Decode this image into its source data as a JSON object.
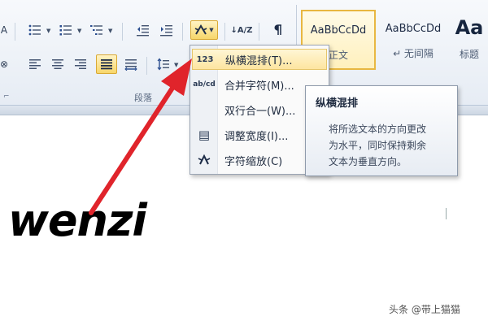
{
  "ribbon": {
    "group_label": "段落",
    "corner_glyph": "⌐",
    "styles": [
      {
        "sample": "AaBbCcDd",
        "name": "正文"
      },
      {
        "sample": "AaBbCcDd",
        "name": "↵ 无间隔"
      },
      {
        "sample": "Aa",
        "name": "标题"
      }
    ],
    "sort_glyph": "↓A/Z",
    "left_glyph_top": "A",
    "left_glyph_bottom": "⊗"
  },
  "menu": {
    "items": [
      {
        "icon": "123",
        "label": "纵横混排(T)..."
      },
      {
        "icon": "ab/cd",
        "label": "合并字符(M)..."
      },
      {
        "icon": "",
        "label": "双行合一(W)..."
      },
      {
        "icon": "▤",
        "label": "调整宽度(I)..."
      },
      {
        "icon": "A̲",
        "label": "字符缩放(C)"
      }
    ]
  },
  "tooltip": {
    "title": "纵横混排",
    "body_line1": "将所选文本的方向更改",
    "body_line2": "为水平，同时保持剩余",
    "body_line3": "文本为垂直方向。"
  },
  "document": {
    "word": "wenzi"
  },
  "watermark": "头条 @带上猫猫",
  "colors": {
    "arrow": "#e0242b",
    "highlight": "#f7d66a",
    "ribbon_bg": "#e6ecf4"
  }
}
